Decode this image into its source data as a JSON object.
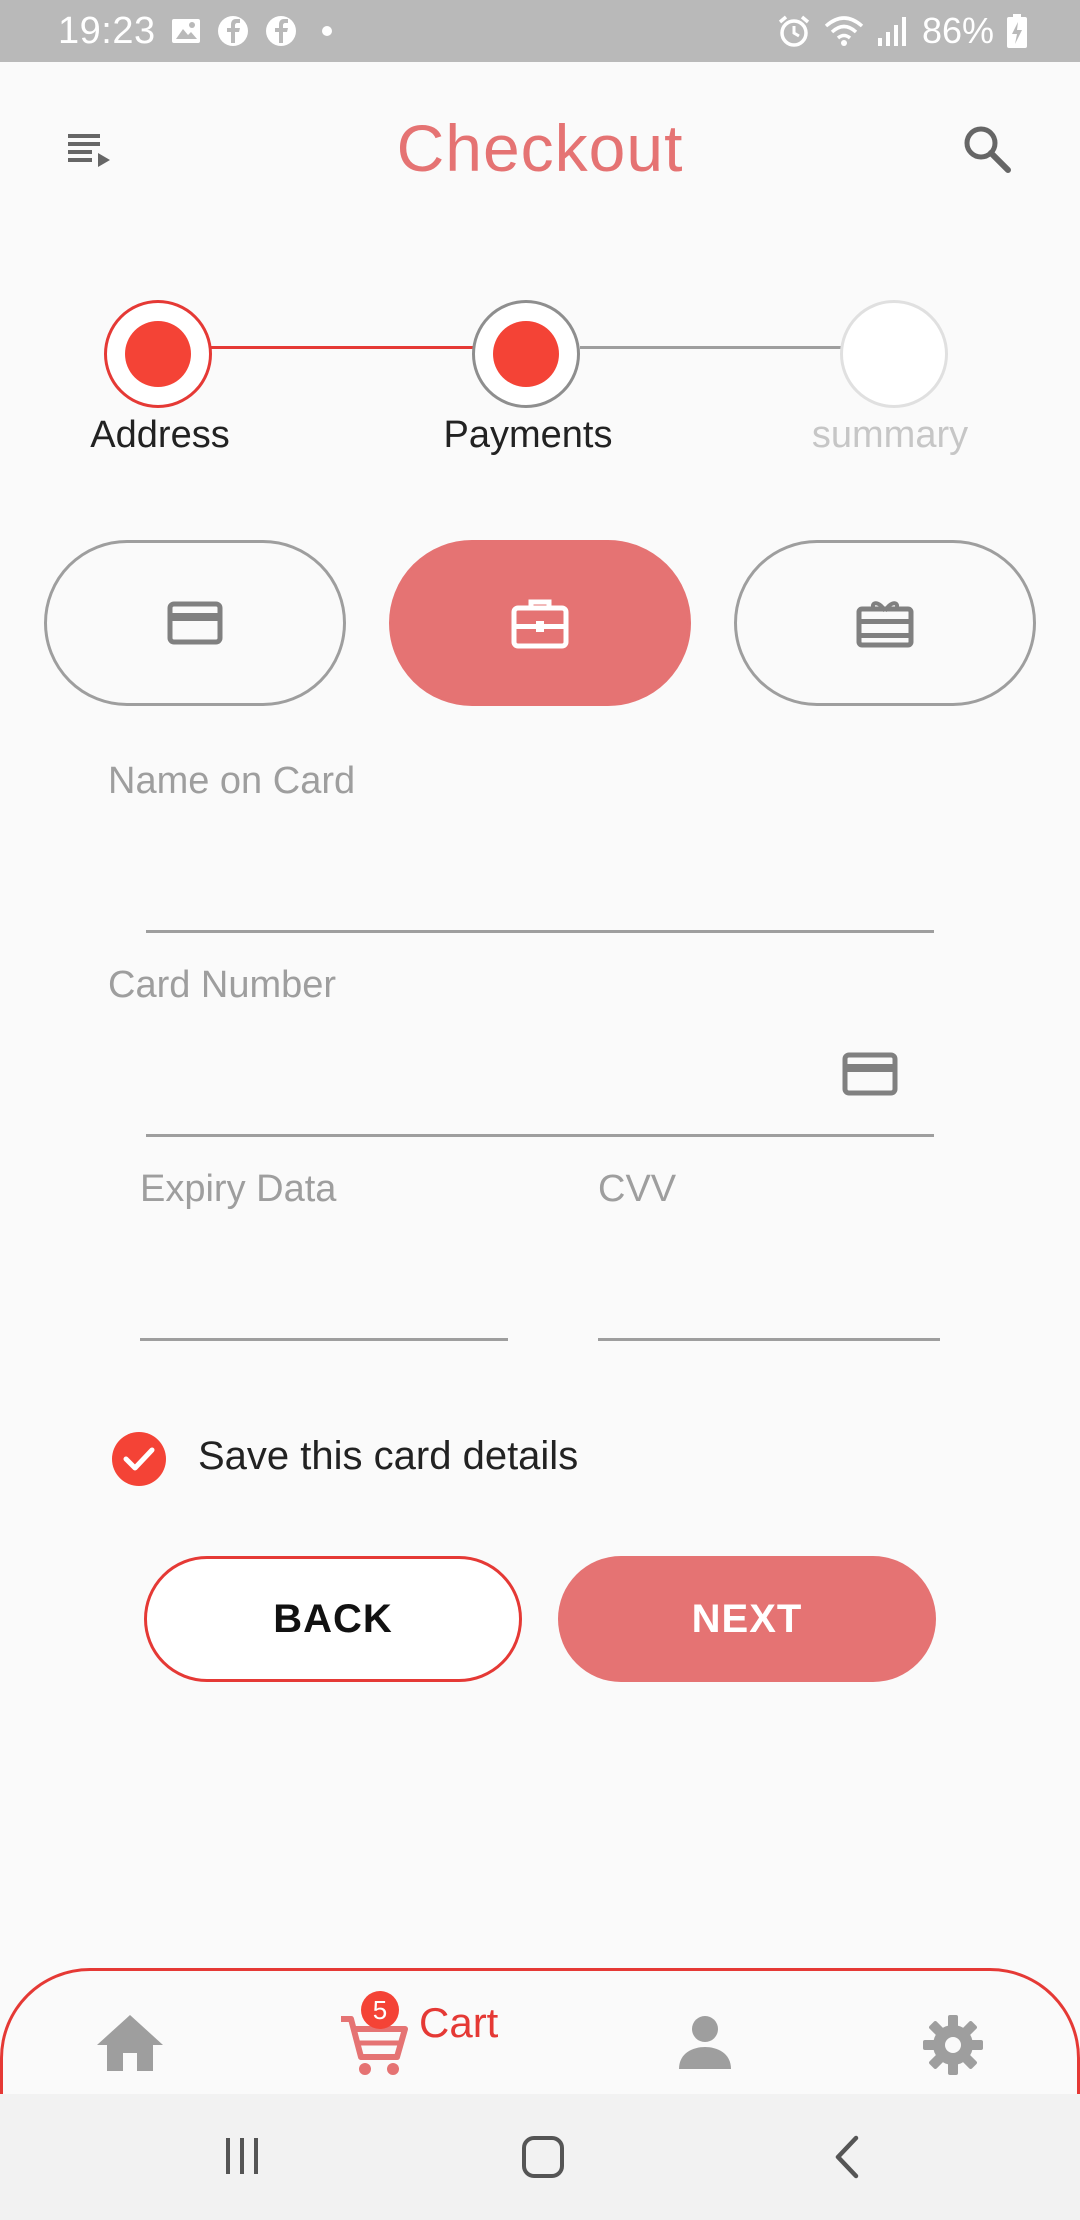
{
  "status_bar": {
    "time": "19:23",
    "battery": "86%",
    "icons_left": [
      "image-icon",
      "facebook-icon",
      "facebook-icon",
      "dot-icon"
    ],
    "icons_right": [
      "alarm-icon",
      "wifi-icon",
      "signal-icon",
      "battery-charging-icon"
    ]
  },
  "app_bar": {
    "title": "Checkout",
    "left_icon": "menu-icon",
    "right_icon": "search-icon",
    "accent_color": "#e57373"
  },
  "stepper": {
    "steps": [
      {
        "label": "Address",
        "state": "complete"
      },
      {
        "label": "Payments",
        "state": "active"
      },
      {
        "label": "summary",
        "state": "inactive"
      }
    ],
    "active_color": "#f44336"
  },
  "payment_methods": [
    {
      "icon": "credit-card-icon",
      "selected": false
    },
    {
      "icon": "briefcase-icon",
      "selected": true
    },
    {
      "icon": "gift-card-icon",
      "selected": false
    }
  ],
  "form": {
    "name_on_card_label": "Name on Card",
    "card_number_label": "Card Number",
    "expiry_label": "Expiry Data",
    "cvv_label": "CVV",
    "name_on_card_value": "",
    "card_number_value": "",
    "expiry_value": "",
    "cvv_value": ""
  },
  "save_card": {
    "label": "Save this card details",
    "checked": true
  },
  "buttons": {
    "back_label": "BACK",
    "next_label": "NEXT"
  },
  "bottom_nav": {
    "items": [
      {
        "icon": "home-icon",
        "label": ""
      },
      {
        "icon": "cart-icon",
        "label": "Cart",
        "badge": "5"
      },
      {
        "icon": "person-icon",
        "label": ""
      },
      {
        "icon": "settings-icon",
        "label": ""
      }
    ]
  },
  "system_nav": [
    "recent-apps-icon",
    "home-button-icon",
    "back-icon"
  ]
}
